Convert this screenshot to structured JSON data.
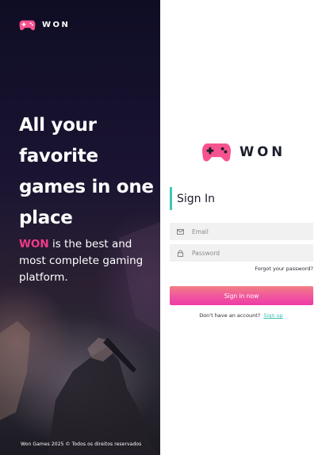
{
  "brand": {
    "name": "WON",
    "logo_icon": "gamepad-icon",
    "accent_color": "#f23a8a",
    "teal_color": "#3cc9b8"
  },
  "hero": {
    "title": "All your favorite games in one place",
    "subtitle_brand": "WON",
    "subtitle_rest": " is the best and most complete gaming platform.",
    "footer": "Won Games 2025 © Todos os direitos reservados"
  },
  "signin": {
    "heading": "Sign In",
    "email_placeholder": "Email",
    "email_icon": "email-icon",
    "password_placeholder": "Password",
    "password_icon": "lock-icon",
    "forgot": "Forgot your password?",
    "submit": "Sign in now",
    "no_account": "Don't have an account?",
    "signup": "Sign up"
  }
}
